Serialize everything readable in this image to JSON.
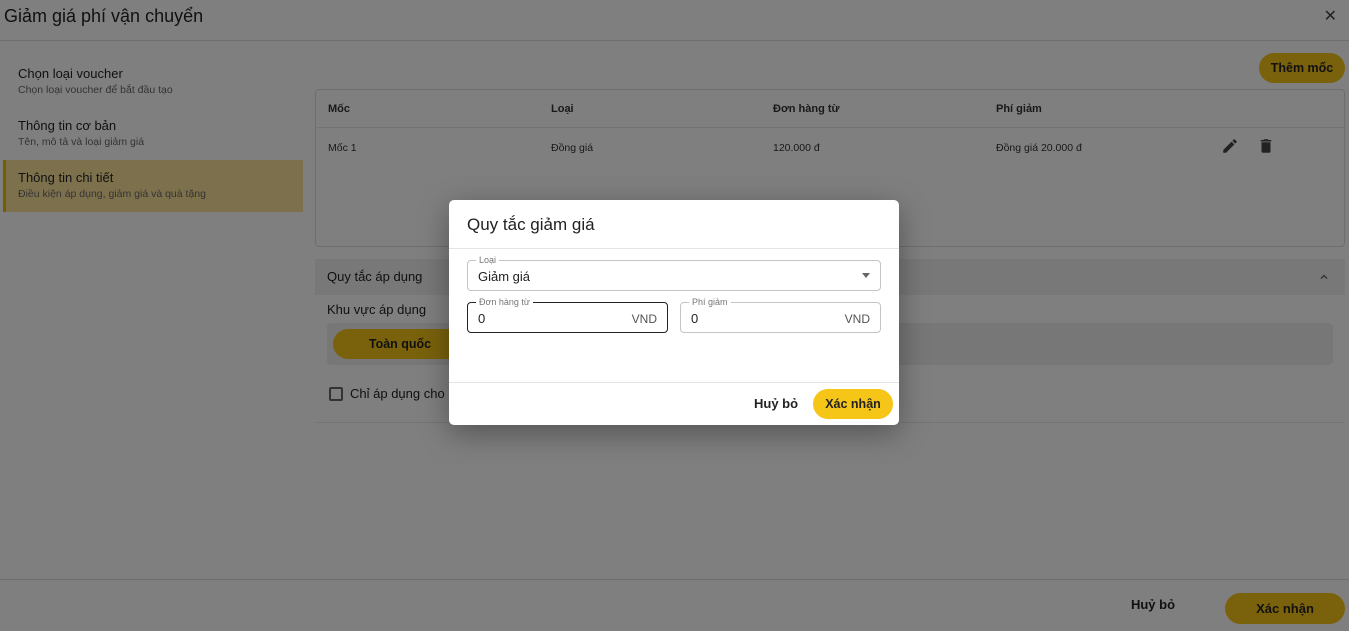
{
  "page": {
    "title": "Giảm giá phí vận chuyển",
    "close_glyph": "✕"
  },
  "sidebar": {
    "items": [
      {
        "title": "Chọn loại voucher",
        "subtitle": "Chọn loại voucher để bắt đầu tạo",
        "active": false
      },
      {
        "title": "Thông tin cơ bản",
        "subtitle": "Tên, mô tả và loại giảm giá",
        "active": false
      },
      {
        "title": "Thông tin chi tiết",
        "subtitle": "Điều kiện áp dụng, giảm giá và quà tặng",
        "active": true
      }
    ]
  },
  "milestones": {
    "add_label": "Thêm mốc",
    "columns": [
      "Mốc",
      "Loại",
      "Đơn hàng từ",
      "Phí giảm"
    ],
    "rows": [
      {
        "moc": "Mốc 1",
        "loai": "Đồng giá",
        "don_hang_tu": "120.000 đ",
        "phi_giam": "Đồng giá 20.000 đ"
      }
    ],
    "row_icons": [
      "pencil-icon",
      "trash-icon"
    ]
  },
  "rules": {
    "title": "Quy tắc áp dụng",
    "area_label": "Khu vực áp dụng",
    "area_selected": "Toàn quốc",
    "checkbox_label": "Chỉ áp dụng cho"
  },
  "footer": {
    "cancel_label": "Huỷ bỏ",
    "confirm_label": "Xác nhận"
  },
  "modal": {
    "title": "Quy tắc giảm giá",
    "type_field": {
      "label": "Loại",
      "value": "Giảm giá"
    },
    "order_from_field": {
      "label": "Đơn hàng từ",
      "value": "0",
      "suffix": "VND"
    },
    "fee_field": {
      "label": "Phí giảm",
      "value": "0",
      "suffix": "VND"
    },
    "cancel_label": "Huỷ bỏ",
    "confirm_label": "Xác nhận"
  },
  "colors": {
    "accent": "#f5c518",
    "active_bg": "#fbe39a",
    "overlay": "rgba(0,0,0,0.5)"
  }
}
